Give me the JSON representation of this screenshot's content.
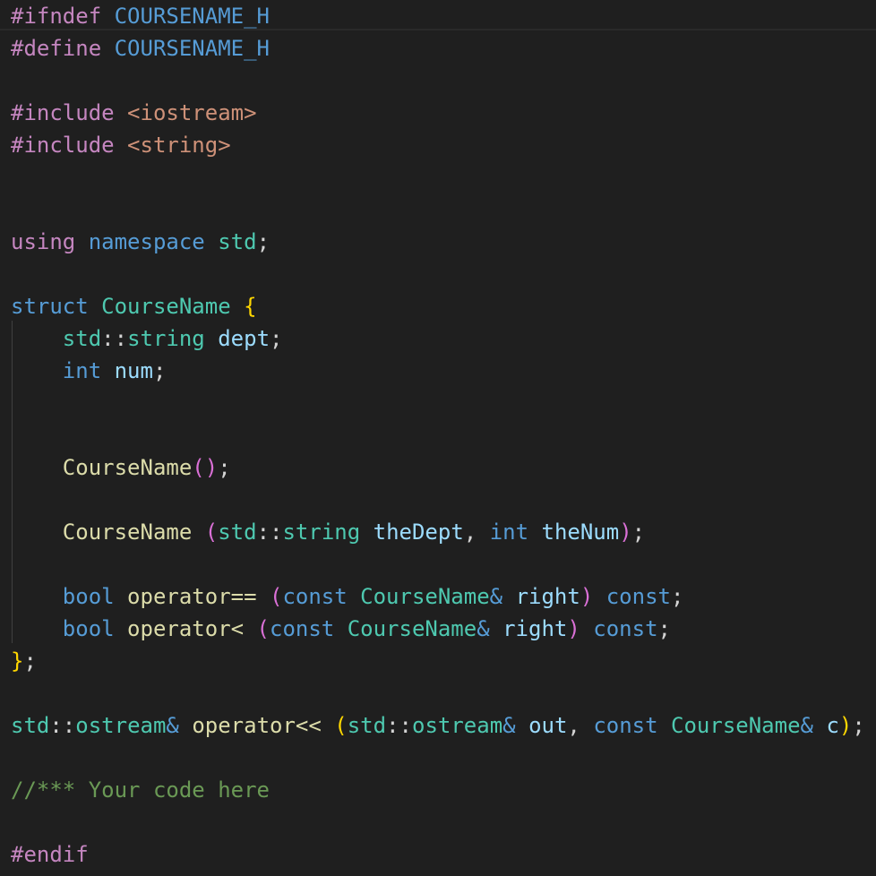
{
  "editor": {
    "lines": [
      [
        {
          "t": "#ifndef",
          "c": "pp"
        },
        {
          "t": " ",
          "c": "punct"
        },
        {
          "t": "COURSENAME_H",
          "c": "macro"
        }
      ],
      [
        {
          "t": "#define",
          "c": "pp"
        },
        {
          "t": " ",
          "c": "punct"
        },
        {
          "t": "COURSENAME_H",
          "c": "macro"
        }
      ],
      [],
      [
        {
          "t": "#include",
          "c": "pp"
        },
        {
          "t": " ",
          "c": "punct"
        },
        {
          "t": "<iostream>",
          "c": "str"
        }
      ],
      [
        {
          "t": "#include",
          "c": "pp"
        },
        {
          "t": " ",
          "c": "punct"
        },
        {
          "t": "<string>",
          "c": "str"
        }
      ],
      [],
      [],
      [
        {
          "t": "using",
          "c": "pp"
        },
        {
          "t": " ",
          "c": "punct"
        },
        {
          "t": "namespace",
          "c": "kw"
        },
        {
          "t": " ",
          "c": "punct"
        },
        {
          "t": "std",
          "c": "type"
        },
        {
          "t": ";",
          "c": "punct"
        }
      ],
      [],
      [
        {
          "t": "struct",
          "c": "kw"
        },
        {
          "t": " ",
          "c": "punct"
        },
        {
          "t": "CourseName",
          "c": "type"
        },
        {
          "t": " ",
          "c": "punct"
        },
        {
          "t": "{",
          "c": "brace"
        }
      ],
      [
        {
          "t": "    ",
          "c": "punct"
        },
        {
          "t": "std",
          "c": "type"
        },
        {
          "t": "::",
          "c": "punct"
        },
        {
          "t": "string",
          "c": "type"
        },
        {
          "t": " ",
          "c": "punct"
        },
        {
          "t": "dept",
          "c": "var"
        },
        {
          "t": ";",
          "c": "punct"
        }
      ],
      [
        {
          "t": "    ",
          "c": "punct"
        },
        {
          "t": "int",
          "c": "kw"
        },
        {
          "t": " ",
          "c": "punct"
        },
        {
          "t": "num",
          "c": "var"
        },
        {
          "t": ";",
          "c": "punct"
        }
      ],
      [],
      [],
      [
        {
          "t": "    ",
          "c": "punct"
        },
        {
          "t": "CourseName",
          "c": "fn"
        },
        {
          "t": "()",
          "c": "paren"
        },
        {
          "t": ";",
          "c": "punct"
        }
      ],
      [],
      [
        {
          "t": "    ",
          "c": "punct"
        },
        {
          "t": "CourseName",
          "c": "fn"
        },
        {
          "t": " ",
          "c": "punct"
        },
        {
          "t": "(",
          "c": "paren"
        },
        {
          "t": "std",
          "c": "type"
        },
        {
          "t": "::",
          "c": "punct"
        },
        {
          "t": "string",
          "c": "type"
        },
        {
          "t": " ",
          "c": "punct"
        },
        {
          "t": "theDept",
          "c": "var"
        },
        {
          "t": ", ",
          "c": "punct"
        },
        {
          "t": "int",
          "c": "kw"
        },
        {
          "t": " ",
          "c": "punct"
        },
        {
          "t": "theNum",
          "c": "var"
        },
        {
          "t": ")",
          "c": "paren"
        },
        {
          "t": ";",
          "c": "punct"
        }
      ],
      [],
      [
        {
          "t": "    ",
          "c": "punct"
        },
        {
          "t": "bool",
          "c": "kw"
        },
        {
          "t": " ",
          "c": "punct"
        },
        {
          "t": "operator==",
          "c": "fn"
        },
        {
          "t": " ",
          "c": "punct"
        },
        {
          "t": "(",
          "c": "paren"
        },
        {
          "t": "const",
          "c": "kw"
        },
        {
          "t": " ",
          "c": "punct"
        },
        {
          "t": "CourseName",
          "c": "type"
        },
        {
          "t": "&",
          "c": "kw"
        },
        {
          "t": " ",
          "c": "punct"
        },
        {
          "t": "right",
          "c": "var"
        },
        {
          "t": ")",
          "c": "paren"
        },
        {
          "t": " ",
          "c": "punct"
        },
        {
          "t": "const",
          "c": "kw"
        },
        {
          "t": ";",
          "c": "punct"
        }
      ],
      [
        {
          "t": "    ",
          "c": "punct"
        },
        {
          "t": "bool",
          "c": "kw"
        },
        {
          "t": " ",
          "c": "punct"
        },
        {
          "t": "operator<",
          "c": "fn"
        },
        {
          "t": " ",
          "c": "punct"
        },
        {
          "t": "(",
          "c": "paren"
        },
        {
          "t": "const",
          "c": "kw"
        },
        {
          "t": " ",
          "c": "punct"
        },
        {
          "t": "CourseName",
          "c": "type"
        },
        {
          "t": "&",
          "c": "kw"
        },
        {
          "t": " ",
          "c": "punct"
        },
        {
          "t": "right",
          "c": "var"
        },
        {
          "t": ")",
          "c": "paren"
        },
        {
          "t": " ",
          "c": "punct"
        },
        {
          "t": "const",
          "c": "kw"
        },
        {
          "t": ";",
          "c": "punct"
        }
      ],
      [
        {
          "t": "}",
          "c": "brace"
        },
        {
          "t": ";",
          "c": "punct"
        }
      ],
      [],
      [
        {
          "t": "std",
          "c": "type"
        },
        {
          "t": "::",
          "c": "punct"
        },
        {
          "t": "ostream",
          "c": "type"
        },
        {
          "t": "&",
          "c": "kw"
        },
        {
          "t": " ",
          "c": "punct"
        },
        {
          "t": "operator<<",
          "c": "fn"
        },
        {
          "t": " ",
          "c": "punct"
        },
        {
          "t": "(",
          "c": "brace"
        },
        {
          "t": "std",
          "c": "type"
        },
        {
          "t": "::",
          "c": "punct"
        },
        {
          "t": "ostream",
          "c": "type"
        },
        {
          "t": "&",
          "c": "kw"
        },
        {
          "t": " ",
          "c": "punct"
        },
        {
          "t": "out",
          "c": "var"
        },
        {
          "t": ", ",
          "c": "punct"
        },
        {
          "t": "const",
          "c": "kw"
        },
        {
          "t": " ",
          "c": "punct"
        },
        {
          "t": "CourseName",
          "c": "type"
        },
        {
          "t": "&",
          "c": "kw"
        },
        {
          "t": " ",
          "c": "punct"
        },
        {
          "t": "c",
          "c": "var"
        },
        {
          "t": ")",
          "c": "brace"
        },
        {
          "t": ";",
          "c": "punct"
        }
      ],
      [],
      [
        {
          "t": "//*** Your code here",
          "c": "cmt"
        }
      ],
      [],
      [
        {
          "t": "#endif",
          "c": "pp"
        }
      ]
    ]
  },
  "colors": {
    "background": "#1f1f1f",
    "keyword": "#569cd6",
    "preprocessor": "#c586c0",
    "string": "#ce9178",
    "type": "#4ec9b0",
    "function": "#dcdcaa",
    "variable": "#9cdcfe",
    "comment": "#6a9955",
    "brace": "#ffd700",
    "paren": "#da70d6",
    "punctuation": "#d4d4d4"
  }
}
